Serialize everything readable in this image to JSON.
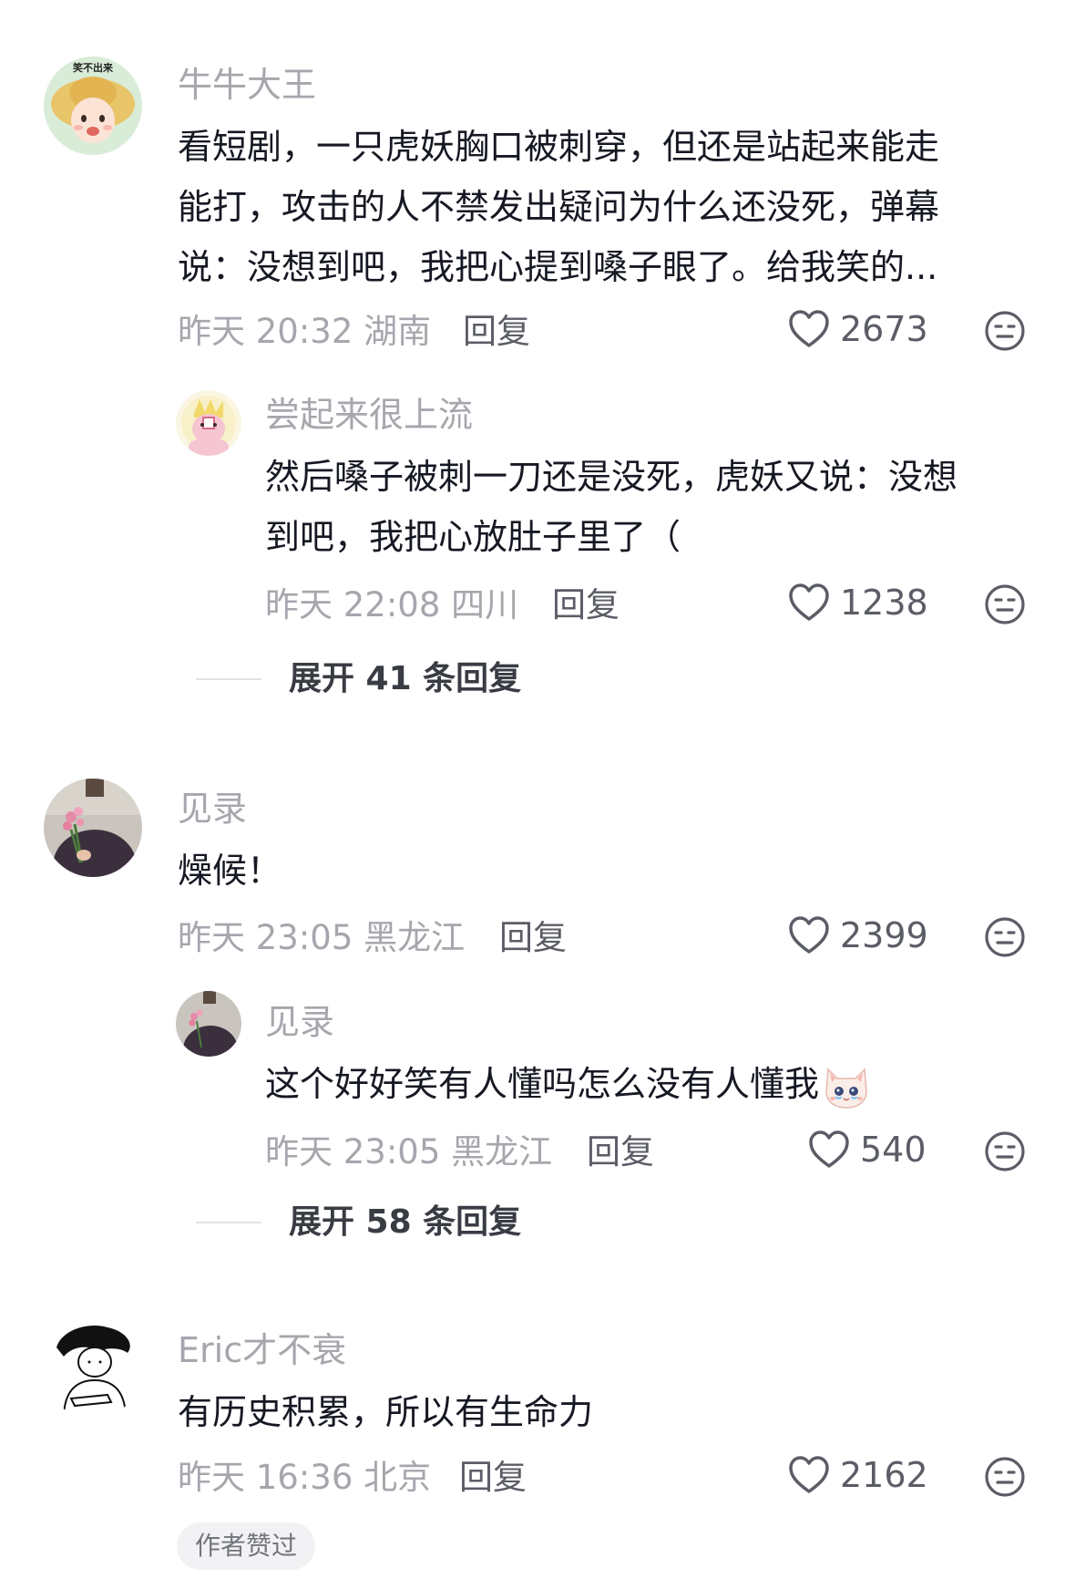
{
  "comments": [
    {
      "username": "牛牛大王",
      "text_lines": [
        "看短剧，一只虎妖胸口被刺穿，但还是站起来能走",
        "能打，攻击的人不禁发出疑问为什么还没死，弹幕",
        "说：没想到吧，我把心提到嗓子眼了。给我笑的..."
      ],
      "time": "昨天 20:32",
      "location": "湖南",
      "reply_label": "回复",
      "likes": "2673",
      "avatar_text": "笑不出来"
    },
    {
      "username": "尝起来很上流",
      "text_lines": [
        "然后嗓子被刺一刀还是没死，虎妖又说：没想",
        "到吧，我把心放肚子里了（"
      ],
      "time": "昨天 22:08",
      "location": "四川",
      "reply_label": "回复",
      "likes": "1238"
    },
    {
      "expand_label": "展开 41 条回复"
    },
    {
      "username": "见录",
      "text_lines": [
        "燥候！"
      ],
      "time": "昨天 23:05",
      "location": "黑龙江",
      "reply_label": "回复",
      "likes": "2399"
    },
    {
      "username": "见录",
      "text_lines": [
        "这个好好笑有人懂吗怎么没有人懂我"
      ],
      "time": "昨天 23:05",
      "location": "黑龙江",
      "reply_label": "回复",
      "likes": "540"
    },
    {
      "expand_label": "展开 58 条回复"
    },
    {
      "username": "Eric才不衰",
      "text_lines": [
        "有历史积累，所以有生命力"
      ],
      "time": "昨天 16:36",
      "location": "北京",
      "reply_label": "回复",
      "likes": "2162",
      "badge": "作者赞过"
    }
  ],
  "icons": {
    "like": "heart-outline-icon",
    "dislike": "meh-face-icon",
    "emoji": "crying-cat-emoji"
  },
  "colors": {
    "username": "#a6a7ad",
    "text": "#161823",
    "meta": "#a6a7ad",
    "reply_link": "#5b5d66",
    "badge_bg": "#f2f2f4"
  }
}
